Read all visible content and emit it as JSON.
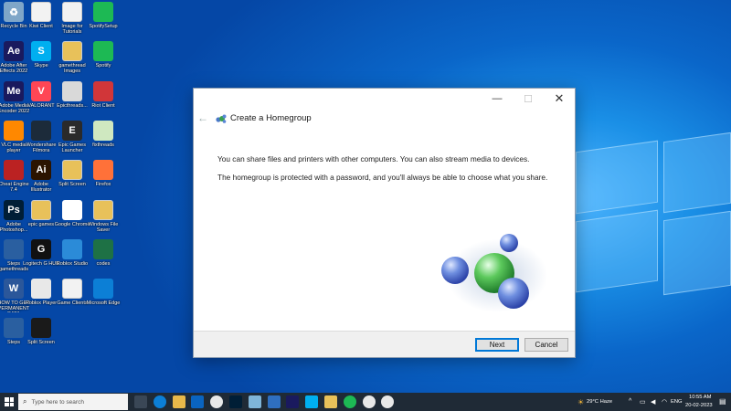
{
  "desktop": {
    "icons": [
      {
        "label": "Recycle Bin",
        "icon": "recycle-bin-icon",
        "color": "#7fa6c8",
        "glyph": "♻"
      },
      {
        "label": "Kiwi Client",
        "icon": "document-icon",
        "color": "#f2f2f2",
        "glyph": ""
      },
      {
        "label": "Image for Tutorials",
        "icon": "document-icon",
        "color": "#f2f2f2",
        "glyph": ""
      },
      {
        "label": "SpotifySetup",
        "icon": "spotify-setup-icon",
        "color": "#1db954",
        "glyph": ""
      },
      {
        "label": "Adobe After Effects 2022",
        "icon": "after-effects-icon",
        "color": "#1a1a5e",
        "glyph": "Ae"
      },
      {
        "label": "Skype",
        "icon": "skype-icon",
        "color": "#00aff0",
        "glyph": "S"
      },
      {
        "label": "gamethread Images",
        "icon": "folder-icon",
        "color": "#e8c15a",
        "glyph": ""
      },
      {
        "label": "Spotify",
        "icon": "spotify-icon",
        "color": "#1db954",
        "glyph": ""
      },
      {
        "label": "Adobe Media Encoder 2022",
        "icon": "media-encoder-icon",
        "color": "#1a1a5e",
        "glyph": "Me"
      },
      {
        "label": "VALORANT",
        "icon": "valorant-icon",
        "color": "#ff4655",
        "glyph": "V"
      },
      {
        "label": "Epicthreads...",
        "icon": "image-file-icon",
        "color": "#d9d9d9",
        "glyph": ""
      },
      {
        "label": "Riot Client",
        "icon": "riot-icon",
        "color": "#d13639",
        "glyph": ""
      },
      {
        "label": "VLC media player",
        "icon": "vlc-icon",
        "color": "#ff8800",
        "glyph": ""
      },
      {
        "label": "Wondershare Filmora",
        "icon": "filmora-icon",
        "color": "#1c2b3a",
        "glyph": ""
      },
      {
        "label": "Epic Games Launcher",
        "icon": "epic-games-icon",
        "color": "#2a2a2a",
        "glyph": "E"
      },
      {
        "label": "fixthreads",
        "icon": "notepad-icon",
        "color": "#cfe8c0",
        "glyph": ""
      },
      {
        "label": "Cheat Engine 7.4",
        "icon": "cheat-engine-icon",
        "color": "#b22",
        "glyph": ""
      },
      {
        "label": "Adobe Illustrator",
        "icon": "illustrator-icon",
        "color": "#2b1400",
        "glyph": "Ai"
      },
      {
        "label": "Split Screen",
        "icon": "folder-icon",
        "color": "#e8c15a",
        "glyph": ""
      },
      {
        "label": "Firefox",
        "icon": "firefox-icon",
        "color": "#ff7139",
        "glyph": ""
      },
      {
        "label": "Adobe Photoshop...",
        "icon": "photoshop-icon",
        "color": "#001e36",
        "glyph": "Ps"
      },
      {
        "label": "epic games",
        "icon": "folder-icon",
        "color": "#e8c15a",
        "glyph": ""
      },
      {
        "label": "Google Chrome",
        "icon": "chrome-icon",
        "color": "#ffffff",
        "glyph": ""
      },
      {
        "label": "Windows File Saver",
        "icon": "folder-icon",
        "color": "#e8c15a",
        "glyph": ""
      },
      {
        "label": "Steps gamethreads",
        "icon": "steps-icon",
        "color": "#2a5fa0",
        "glyph": ""
      },
      {
        "label": "Logitech G HUB",
        "icon": "logitech-icon",
        "color": "#111111",
        "glyph": "G"
      },
      {
        "label": "Roblox Studio",
        "icon": "roblox-studio-icon",
        "color": "#2b8bd8",
        "glyph": ""
      },
      {
        "label": "codes",
        "icon": "excel-file-icon",
        "color": "#1e7145",
        "glyph": ""
      },
      {
        "label": "HOW TO GET PERMANENT DATA",
        "icon": "word-doc-icon",
        "color": "#2b579a",
        "glyph": "W"
      },
      {
        "label": "Roblox Player",
        "icon": "roblox-icon",
        "color": "#e8e8e8",
        "glyph": ""
      },
      {
        "label": "Game Clients",
        "icon": "document-icon",
        "color": "#f2f2f2",
        "glyph": ""
      },
      {
        "label": "Microsoft Edge",
        "icon": "edge-icon",
        "color": "#0c7fd6",
        "glyph": ""
      },
      {
        "label": "Steps",
        "icon": "steps-icon",
        "color": "#2a5fa0",
        "glyph": ""
      },
      {
        "label": "Split Screen",
        "icon": "split-screen-icon",
        "color": "#1a1a1a",
        "glyph": ""
      }
    ]
  },
  "dialog": {
    "title": "Create a Homegroup",
    "paragraph1": "You can share files and printers with other computers. You can also stream media to devices.",
    "paragraph2": "The homegroup is protected with a password, and you'll always be able to choose what you share.",
    "next_label": "Next",
    "cancel_label": "Cancel",
    "minimize_glyph": "—",
    "maximize_glyph": "☐",
    "close_glyph": "✕",
    "back_glyph": "←"
  },
  "taskbar": {
    "search_placeholder": "Type here to search",
    "apps": [
      "task-view-icon",
      "edge-icon",
      "file-explorer-icon",
      "mail-icon",
      "chrome-icon",
      "photoshop-icon",
      "notepad-icon",
      "store-icon",
      "media-encoder-icon",
      "skype-icon",
      "folder-icon",
      "spotify-icon",
      "chrome-icon",
      "chrome-icon"
    ],
    "weather": "29°C  Haze",
    "language": "ENG",
    "time": "10:55 AM",
    "date": "20-02-2023"
  },
  "colors": {
    "accent": "#0078d7",
    "taskbar": "#1f2a36"
  }
}
